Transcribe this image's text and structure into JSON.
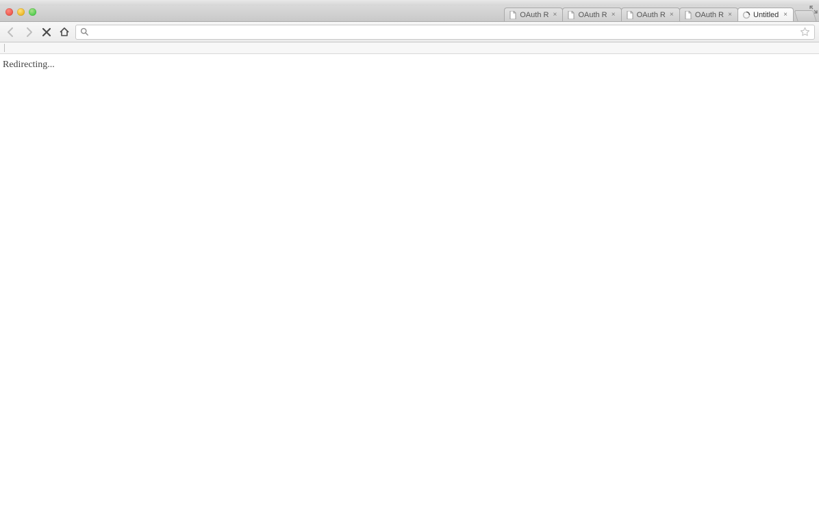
{
  "window": {
    "traffic_lights": [
      "close",
      "minimize",
      "zoom"
    ]
  },
  "tabs": [
    {
      "label": "OAuth R",
      "active": false,
      "favicon": "page-icon"
    },
    {
      "label": "OAuth R",
      "active": false,
      "favicon": "page-icon"
    },
    {
      "label": "OAuth R",
      "active": false,
      "favicon": "page-icon"
    },
    {
      "label": "OAuth R",
      "active": false,
      "favicon": "page-icon"
    },
    {
      "label": "Untitled",
      "active": true,
      "favicon": "loading-icon"
    }
  ],
  "toolbar": {
    "back_enabled": false,
    "forward_enabled": false,
    "reload_stop_mode": "stop",
    "address_value": ""
  },
  "page": {
    "body_text": "Redirecting..."
  }
}
